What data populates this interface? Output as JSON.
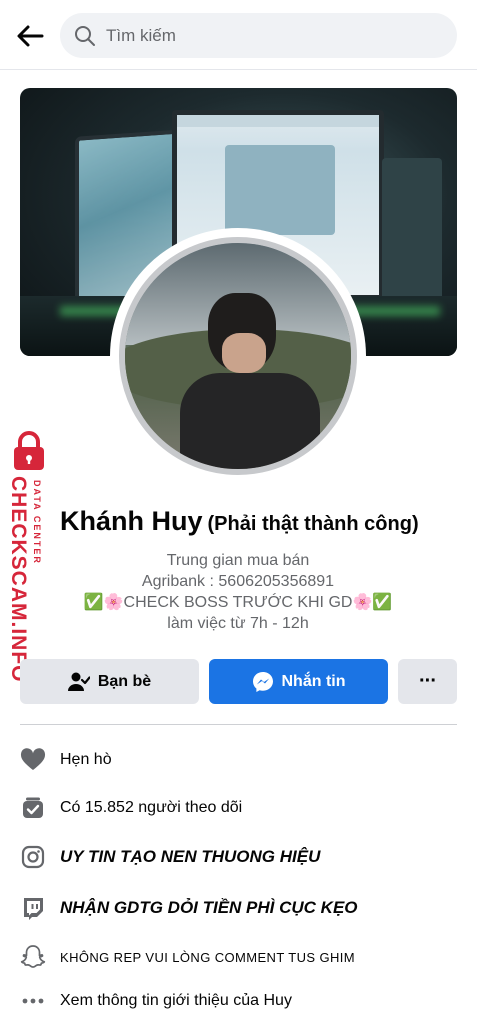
{
  "header": {
    "search_placeholder": "Tìm kiếm"
  },
  "watermark": {
    "brand": "CHECKSCAM.INFO",
    "tagline": "DATA CENTER"
  },
  "profile": {
    "name": "Khánh Huy",
    "nickname": "(Phải thật thành công)",
    "bio": [
      "Trung gian mua bán",
      "Agribank : 5606205356891",
      "✅🌸CHECK BOSS TRƯỚC KHI GD🌸✅",
      "làm việc từ 7h - 12h"
    ]
  },
  "actions": {
    "friends_label": "Bạn bè",
    "message_label": "Nhắn tin",
    "more_label": "···"
  },
  "details": [
    {
      "icon": "heart-icon",
      "text": "Hẹn hò"
    },
    {
      "icon": "followers-icon",
      "text": "Có 15.852 người theo dõi"
    },
    {
      "icon": "instagram-icon",
      "text": "UY TIN TẠO NEN THUONG HIỆU"
    },
    {
      "icon": "twitch-icon",
      "text": "NHẬN GDTG DỎI TIỀN PHÌ CỤC KẸO"
    },
    {
      "icon": "snapchat-icon",
      "text": "KHÔNG REP VUI LÒNG COMMENT TUS GHIM"
    },
    {
      "icon": "more-dots-icon",
      "text": "Xem thông tin giới thiệu của Huy"
    }
  ],
  "colors": {
    "accent": "#1b74e4",
    "watermark": "#d6263a",
    "icon_gray": "#65676b"
  }
}
